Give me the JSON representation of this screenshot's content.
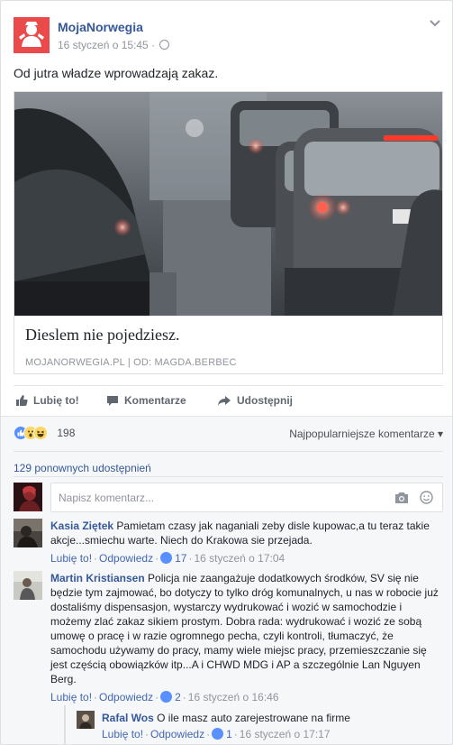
{
  "post": {
    "page_name": "MojaNorwegia",
    "timestamp": "16 styczeń o 15:45",
    "meta_separator": "·",
    "text": "Od jutra władze wprowadzają zakaz."
  },
  "link_preview": {
    "title": "Dieslem nie pojedziesz.",
    "source": "MOJANORWEGIA.PL | OD: MAGDA.BERBEC"
  },
  "actions": {
    "like_label": "Lubię to!",
    "comment_label": "Komentarze",
    "share_label": "Udostępnij"
  },
  "feedback": {
    "reaction_count": "198",
    "reaction_icons": [
      "like-icon",
      "wow-icon",
      "haha-icon"
    ],
    "sort_label": "Najpopularniejsze komentarze ▾",
    "shares_label": "129 ponownych udostępnień",
    "comment_placeholder": "Napisz komentarz..."
  },
  "comments": [
    {
      "author": "Kasia Ziętek",
      "text": "Pamietam czasy jak naganiali zeby disle kupowac,a tu teraz takie akcje...smiechu warte. Niech do Krakowa sie przejada.",
      "like_label": "Lubię to!",
      "reply_label": "Odpowiedz",
      "likes": "17",
      "time": "16 styczeń o 17:04"
    },
    {
      "author": "Martin Kristiansen",
      "text": "Policja nie zaangażuje dodatkowych środków, SV się nie będzie tym zajmować, bo dotyczy to tylko dróg komunalnych, u nas w robocie już dostaliśmy dispensasjon, wystarczy wydrukować i wozić w samochodzie i możemy zlać zakaz sikiem prostym. Dobra rada: wydrukować i wozić ze sobą umowę o pracę i w razie ogromnego pecha, czyli kontroli, tłumaczyć, że samochodu używamy do pracy, mamy wiele miejsc pracy, przemieszczanie się jest częścią obowiązków itp...A i CHWD MDG i AP a szczególnie Lan Nguyen Berg.",
      "like_label": "Lubię to!",
      "reply_label": "Odpowiedz",
      "likes": "2",
      "time": "16 styczeń o 16:46"
    }
  ],
  "reply": {
    "author": "Rafal Wos",
    "text": "O ile masz auto zarejestrowane na firme",
    "like_label": "Lubię to!",
    "reply_label": "Odpowiedz",
    "likes": "1",
    "time": "16 styczeń o 17:17"
  },
  "colors": {
    "link_blue": "#365899",
    "brand_red": "#ea4a4a",
    "like_blue": "#5890ff"
  }
}
